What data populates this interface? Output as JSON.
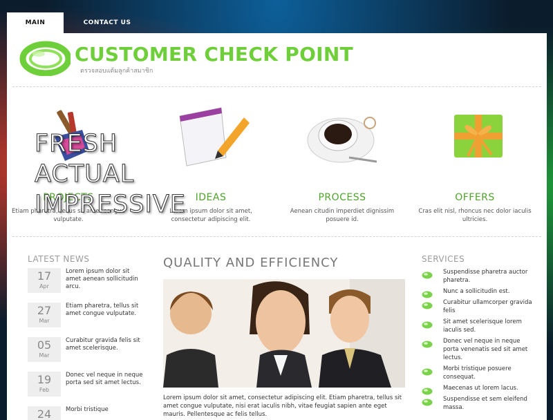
{
  "nav": {
    "tabs": [
      "MAIN",
      "CONTACT US"
    ]
  },
  "header": {
    "title": "CUSTOMER CHECK POINT",
    "subtitle": "ตรวจสอบแต้มลูกค้าสมาชิก"
  },
  "features": [
    {
      "title": "PROJECTS",
      "desc": "Etiam pharetra, tellus sit amet congue vulputate.",
      "icon": "paint-brushes-icon"
    },
    {
      "title": "IDEAS",
      "desc": "Lorem ipsum dolor sit amet, consectetur adipiscing elit.",
      "icon": "notepad-pencil-icon"
    },
    {
      "title": "PROCESS",
      "desc": "Aenean citudin imperdiet dignissim posuere id.",
      "icon": "coffee-cup-icon"
    },
    {
      "title": "OFFERS",
      "desc": "Cras elit nisl, rhoncus nec dolor iaculis ultricies.",
      "icon": "gift-box-icon"
    }
  ],
  "overlay": {
    "lines": [
      "FRESH",
      "ACTUAL",
      "IMPRESSIVE"
    ]
  },
  "news": {
    "heading": "LATEST NEWS",
    "items": [
      {
        "day": "17",
        "month": "Apr",
        "text": "Lorem ipsum dolor sit amet aenean sollicitudin arcu."
      },
      {
        "day": "27",
        "month": "Mar",
        "text": "Etiam pharetra, tellus sit amet congue vulputate."
      },
      {
        "day": "05",
        "month": "Mar",
        "text": "Curabitur gravida felis sit amet scelerisque."
      },
      {
        "day": "19",
        "month": "Feb",
        "text": "Donec vel neque in neque porta sed sit amet lectus."
      },
      {
        "day": "24",
        "month": "",
        "text": "Morbi tristique"
      }
    ]
  },
  "main": {
    "title": "QUALITY AND EFFICIENCY",
    "text": "Lorem ipsum dolor sit amet, consectetur adipiscing elit. Etiam pharetra, tellus sit amet congue vulputate, nisi erat iaculis nibh, vitae feugiat sapien ante eget mauris. Pellentesque ac felis tellus."
  },
  "services": {
    "heading": "SERVICES",
    "items": [
      "Suspendisse pharetra auctor pharetra.",
      "Nunc a sollicitudin est.",
      "Curabitur ullamcorper gravida felis",
      "Sit amet scelerisque lorem iaculis sed.",
      "Donec vel neque in neque porta venenatis sed sit amet lectus.",
      "Morbi tristique posuere consequat.",
      "Maecenas ut lorem lacus.",
      "Suspendisse et sem eleifend massa."
    ]
  },
  "colors": {
    "accent_green": "#6fcf3a",
    "title_green": "#4ea32a",
    "heading_gray": "#9a9a9a"
  }
}
